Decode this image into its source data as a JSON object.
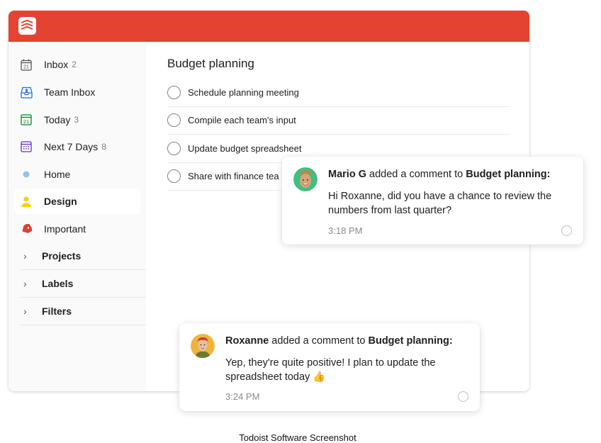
{
  "app": {
    "brand_color": "#e44332",
    "logo_icon": "todoist-logo-icon"
  },
  "sidebar": {
    "items": [
      {
        "label": "Inbox",
        "count": "2",
        "icon": "inbox-calendar-icon",
        "icon_color": "#555555"
      },
      {
        "label": "Team Inbox",
        "count": "",
        "icon": "team-inbox-icon",
        "icon_color": "#246fe0"
      },
      {
        "label": "Today",
        "count": "3",
        "icon": "today-calendar-icon",
        "icon_color": "#058527"
      },
      {
        "label": "Next 7 Days",
        "count": "8",
        "icon": "upcoming-calendar-icon",
        "icon_color": "#692fc2"
      },
      {
        "label": "Home",
        "count": "",
        "icon": "project-dot-icon",
        "icon_color": "#96c3eb"
      },
      {
        "label": "Design",
        "count": "",
        "icon": "person-icon",
        "icon_color": "#fad000",
        "active": true
      },
      {
        "label": "Important",
        "count": "",
        "icon": "label-tag-icon",
        "icon_color": "#db4035"
      }
    ],
    "sections": [
      {
        "label": "Projects"
      },
      {
        "label": "Labels"
      },
      {
        "label": "Filters"
      }
    ]
  },
  "main": {
    "project_title": "Budget planning",
    "tasks": [
      {
        "label": "Schedule planning meeting"
      },
      {
        "label": "Compile each team's input"
      },
      {
        "label": "Update budget spreadsheet"
      },
      {
        "label": "Share with finance tea"
      }
    ]
  },
  "comments": [
    {
      "author": "Mario G",
      "action": " added a comment to ",
      "target": "Budget planning:",
      "body": "Hi Roxanne, did you have a chance to review the numbers from last quarter?",
      "time": "3:18 PM",
      "avatar_color": "#3fbf80"
    },
    {
      "author": "Roxanne",
      "action": " added a comment to ",
      "target": "Budget planning:",
      "body": "Yep, they're quite positive! I plan to update the spreadsheet today 👍",
      "time": "3:24 PM",
      "avatar_color": "#f0b43c"
    }
  ],
  "caption": "Todoist Software Screenshot"
}
